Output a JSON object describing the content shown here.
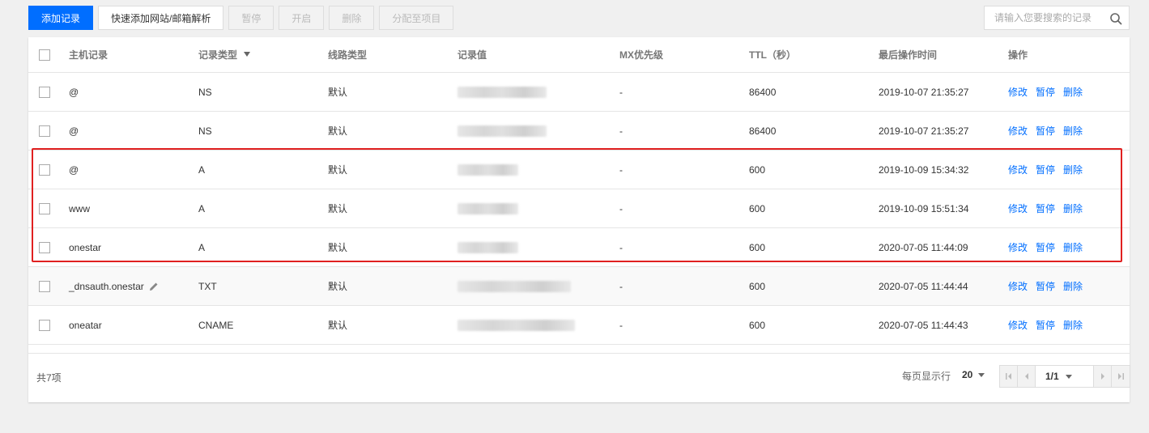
{
  "toolbar": {
    "add_record": "添加记录",
    "quick_add": "快速添加网站/邮箱解析",
    "pause": "暂停",
    "enable": "开启",
    "delete": "删除",
    "assign_project": "分配至项目"
  },
  "search": {
    "placeholder": "请输入您要搜索的记录",
    "icon": "search-icon"
  },
  "table": {
    "headers": {
      "host": "主机记录",
      "type": "记录类型",
      "line": "线路类型",
      "value": "记录值",
      "mx": "MX优先级",
      "ttl": "TTL（秒）",
      "time": "最后操作时间",
      "ops": "操作"
    },
    "rows": [
      {
        "host": "@",
        "type": "NS",
        "line": "默认",
        "mx": "-",
        "ttl": "86400",
        "time": "2019-10-07 21:35:27"
      },
      {
        "host": "@",
        "type": "NS",
        "line": "默认",
        "mx": "-",
        "ttl": "86400",
        "time": "2019-10-07 21:35:27"
      },
      {
        "host": "@",
        "type": "A",
        "line": "默认",
        "mx": "-",
        "ttl": "600",
        "time": "2019-10-09 15:34:32"
      },
      {
        "host": "www",
        "type": "A",
        "line": "默认",
        "mx": "-",
        "ttl": "600",
        "time": "2019-10-09 15:51:34"
      },
      {
        "host": "onestar",
        "type": "A",
        "line": "默认",
        "mx": "-",
        "ttl": "600",
        "time": "2020-07-05 11:44:09"
      },
      {
        "host": "_dnsauth.onestar",
        "type": "TXT",
        "line": "默认",
        "mx": "-",
        "ttl": "600",
        "time": "2020-07-05 11:44:44"
      },
      {
        "host": "oneatar",
        "type": "CNAME",
        "line": "默认",
        "mx": "-",
        "ttl": "600",
        "time": "2020-07-05 11:44:43"
      }
    ],
    "ops": {
      "edit": "修改",
      "pause": "暂停",
      "delete": "删除"
    }
  },
  "footer": {
    "total": "共7项",
    "per_page_label": "每页显示行",
    "per_page": "20",
    "page": "1/1"
  },
  "colors": {
    "accent": "#006eff",
    "highlight_box": "#e02020"
  }
}
